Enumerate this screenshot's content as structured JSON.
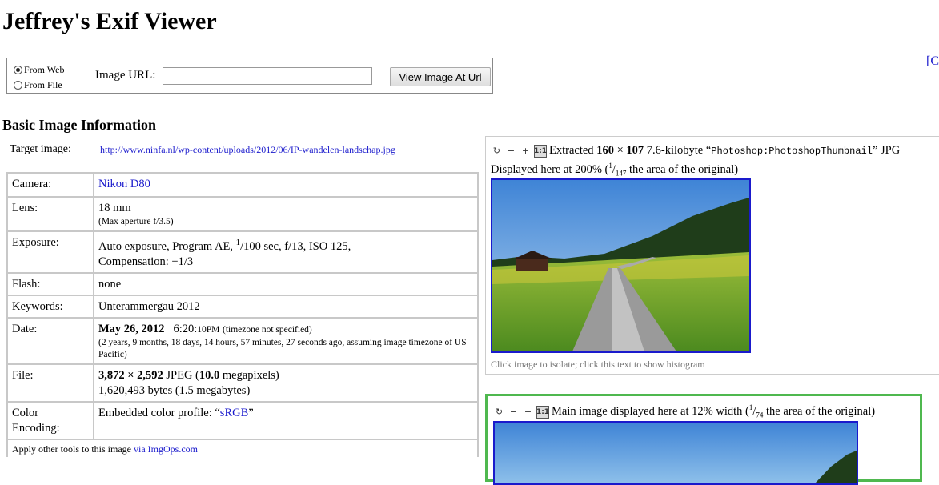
{
  "page": {
    "title": "Jeffrey's Exif Viewer",
    "corner_text": "[C"
  },
  "url_form": {
    "radio_web": "From Web",
    "radio_file": "From File",
    "selected": "From Web",
    "url_label": "Image URL:",
    "url_value": "",
    "submit_label": "View Image At Url"
  },
  "basic_info": {
    "heading": "Basic Image Information",
    "target_label": "Target image:",
    "target_url": "http://www.ninfa.nl/wp-content/uploads/2012/06/IP-wandelen-landschap.jpg",
    "rows": {
      "camera": {
        "label": "Camera:",
        "value": "Nikon D80"
      },
      "lens": {
        "label": "Lens:",
        "value": "18 mm",
        "note": "(Max aperture f/3.5)"
      },
      "exposure": {
        "label": "Exposure:",
        "pre": "Auto exposure, Program AE,",
        "num": "1",
        "den": "100 sec, f/13, ISO 125,",
        "line2": "Compensation: +1/3"
      },
      "flash": {
        "label": "Flash:",
        "value": "none"
      },
      "keywords": {
        "label": "Keywords:",
        "value": "Unterammergau 2012"
      },
      "date": {
        "label": "Date:",
        "date": "May 26, 2012",
        "time": "6:20:",
        "time_small": "10PM",
        "tz": "(timezone not specified)",
        "ago": "(2 years, 9 months, 18 days, 14 hours, 57 minutes, 27 seconds ago, assuming image timezone of US Pacific)"
      },
      "file": {
        "label": "File:",
        "dims": "3,872 × 2,592",
        "format": "JPEG (",
        "mp": "10.0",
        "mp_tail": "megapixels)",
        "bytes": "1,620,493 bytes (1.5 megabytes)"
      },
      "color": {
        "label": "Color Encoding:",
        "pre": "Embedded color profile: “",
        "profile": "sRGB",
        "post": "”"
      }
    },
    "footer_text": "Apply other tools to this image",
    "footer_link": "via ImgOps.com"
  },
  "thumb_panel": {
    "tools": {
      "rotate": "↻",
      "zoom_out": "−",
      "zoom_in": "+",
      "actual": "1:1"
    },
    "extracted_pre": "Extracted",
    "w": "160",
    "times": "×",
    "h": "107",
    "size": "7.6-kilobyte “",
    "source": "Photoshop:PhotoshopThumbnail",
    "post": "” JPG",
    "displayed_pre": "Displayed here at 200% (",
    "frac_num": "1",
    "frac_den": "147",
    "displayed_post": "the area of the original)",
    "caption": "Click image to isolate; click this text to show histogram"
  },
  "main_panel": {
    "text_pre": "Main image displayed here at 12% width (",
    "frac_num": "1",
    "frac_den": "74",
    "text_post": "the area of the original)"
  },
  "colors": {
    "link": "#1a1acc",
    "main_border": "#4fb84f",
    "table_border": "#c8c8c8"
  }
}
